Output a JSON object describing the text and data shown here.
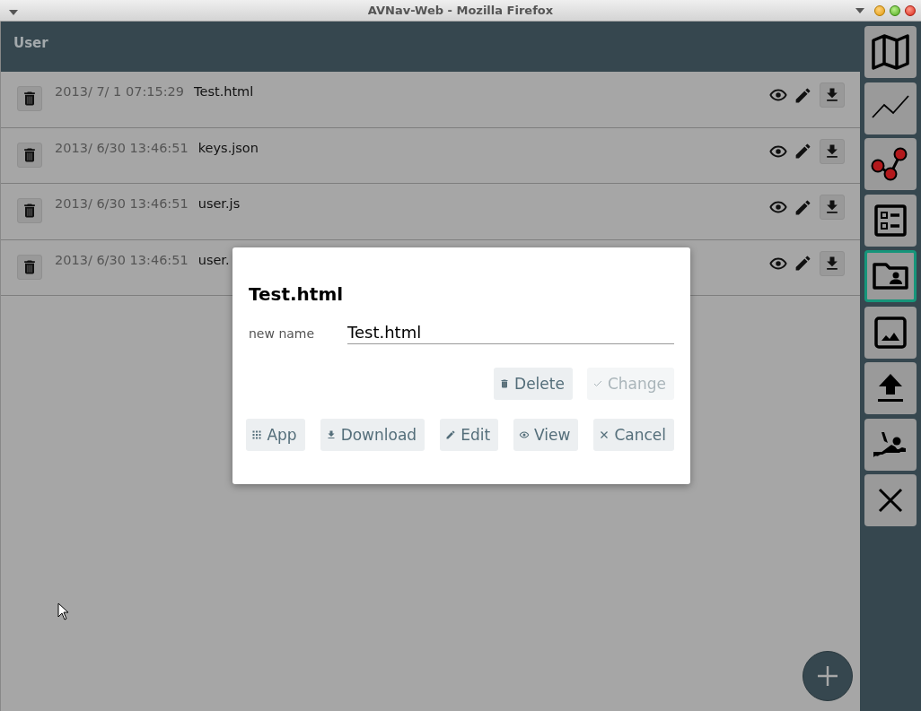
{
  "window": {
    "title": "AVNav-Web - Mozilla Firefox"
  },
  "header": {
    "title": "User"
  },
  "files": [
    {
      "date": "2013/ 7/ 1 07:15:29",
      "name": "Test.html"
    },
    {
      "date": "2013/ 6/30 13:46:51",
      "name": "keys.json"
    },
    {
      "date": "2013/ 6/30 13:46:51",
      "name": "user.js"
    },
    {
      "date": "2013/ 6/30 13:46:51",
      "name": "user."
    }
  ],
  "sidebar": {
    "buttons": [
      {
        "kind": "map",
        "selected": false
      },
      {
        "kind": "track",
        "selected": false
      },
      {
        "kind": "route",
        "selected": false
      },
      {
        "kind": "list",
        "selected": false
      },
      {
        "kind": "user-files",
        "selected": true
      },
      {
        "kind": "images",
        "selected": false
      },
      {
        "kind": "upload",
        "selected": false
      },
      {
        "kind": "overboard",
        "selected": false
      },
      {
        "kind": "close",
        "selected": false
      }
    ]
  },
  "dialog": {
    "title": "Test.html",
    "field": {
      "label": "new name",
      "value": "Test.html"
    },
    "button_rows": [
      [
        {
          "kind": "delete",
          "label": "Delete",
          "disabled": false
        },
        {
          "kind": "change",
          "label": "Change",
          "disabled": true
        }
      ],
      [
        {
          "kind": "app",
          "label": "App",
          "disabled": false
        },
        {
          "kind": "download",
          "label": "Download",
          "disabled": false
        },
        {
          "kind": "edit",
          "label": "Edit",
          "disabled": false
        },
        {
          "kind": "view",
          "label": "View",
          "disabled": false
        },
        {
          "kind": "cancel",
          "label": "Cancel",
          "disabled": false
        }
      ]
    ]
  }
}
